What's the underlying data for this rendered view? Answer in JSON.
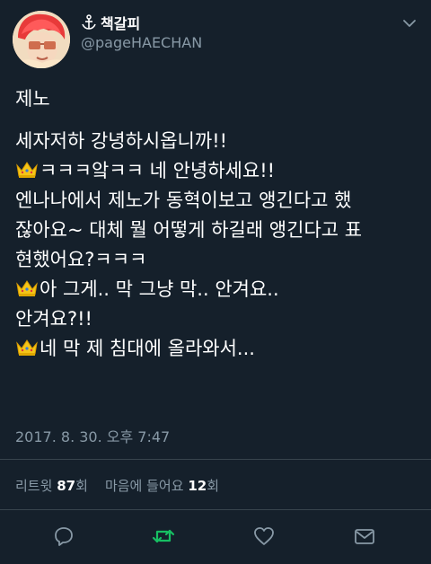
{
  "user": {
    "display_name": "책갈피",
    "handle": "@pageHAECHAN"
  },
  "tweet": {
    "lines": [
      "제노",
      "세자저하 강녕하시옵니까!!",
      "ㅋㅋㅋ앜ㅋㅋ 네 안녕하세요!!",
      "엔나나에서 제노가 동혁이보고 앵긴다고 했",
      "잖아요~ 대체 뭘 어떻게 하길래 앵긴다고 표",
      "현했어요?ㅋㅋㅋ",
      "아 그게.. 막 그냥 막.. 안겨요..",
      "안겨요?!!",
      "네 막 제 침대에 올라와서..."
    ],
    "timestamp": "2017. 8. 30. 오후 7:47"
  },
  "stats": {
    "retweets_label": "리트윗",
    "retweets_count": "87",
    "retweets_unit": "회",
    "likes_label": "마음에 들어요",
    "likes_count": "12",
    "likes_unit": "회"
  },
  "colors": {
    "background": "#15202b",
    "text": "#ffffff",
    "secondary_text": "#8899a6",
    "retweet_active": "#17bf63",
    "divider": "#38444d"
  },
  "icons": {
    "header": [
      "anchor-icon",
      "chevron-down-icon"
    ],
    "inline": "crown-emoji",
    "actions": [
      "reply-icon",
      "retweet-icon",
      "like-icon",
      "share-icon"
    ]
  }
}
